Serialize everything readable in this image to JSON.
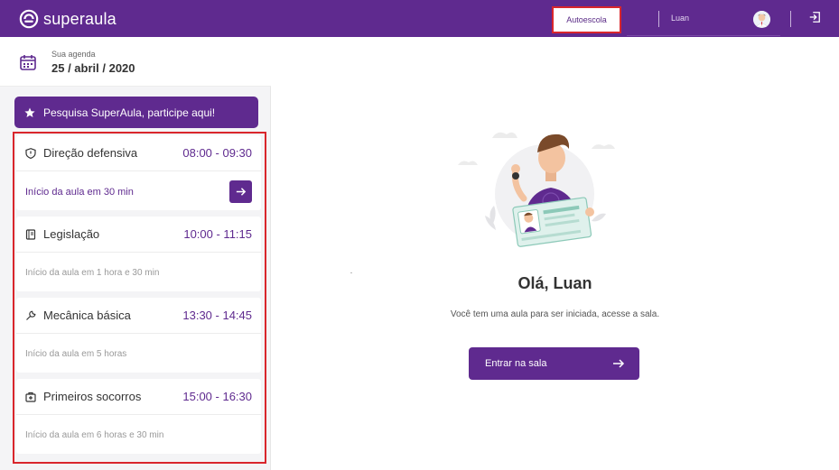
{
  "header": {
    "brand": "superaula",
    "school": "Autoescola",
    "user_name": "Luan"
  },
  "agenda": {
    "label": "Sua agenda",
    "date": "25 / abril / 2020"
  },
  "survey": {
    "label": "Pesquisa SuperAula, participe aqui!"
  },
  "lessons": [
    {
      "icon": "shield-icon",
      "title": "Direção defensiva",
      "time": "08:00 - 09:30",
      "status": "Início da aula em 30 min",
      "active": true
    },
    {
      "icon": "book-icon",
      "title": "Legislação",
      "time": "10:00 - 11:15",
      "status": "Início da aula em 1 hora e 30 min",
      "active": false
    },
    {
      "icon": "wrench-icon",
      "title": "Mecânica básica",
      "time": "13:30 - 14:45",
      "status": "Início da aula em 5 horas",
      "active": false
    },
    {
      "icon": "first-aid-icon",
      "title": "Primeiros socorros",
      "time": "15:00 - 16:30",
      "status": "Início da aula em 6 horas e 30 min",
      "active": false
    }
  ],
  "main": {
    "greeting": "Olá, Luan",
    "message": "Você tem uma aula para ser iniciada, acesse a sala.",
    "button": "Entrar na sala"
  },
  "colors": {
    "brand": "#5f2a8f",
    "highlight": "#d9262c"
  }
}
